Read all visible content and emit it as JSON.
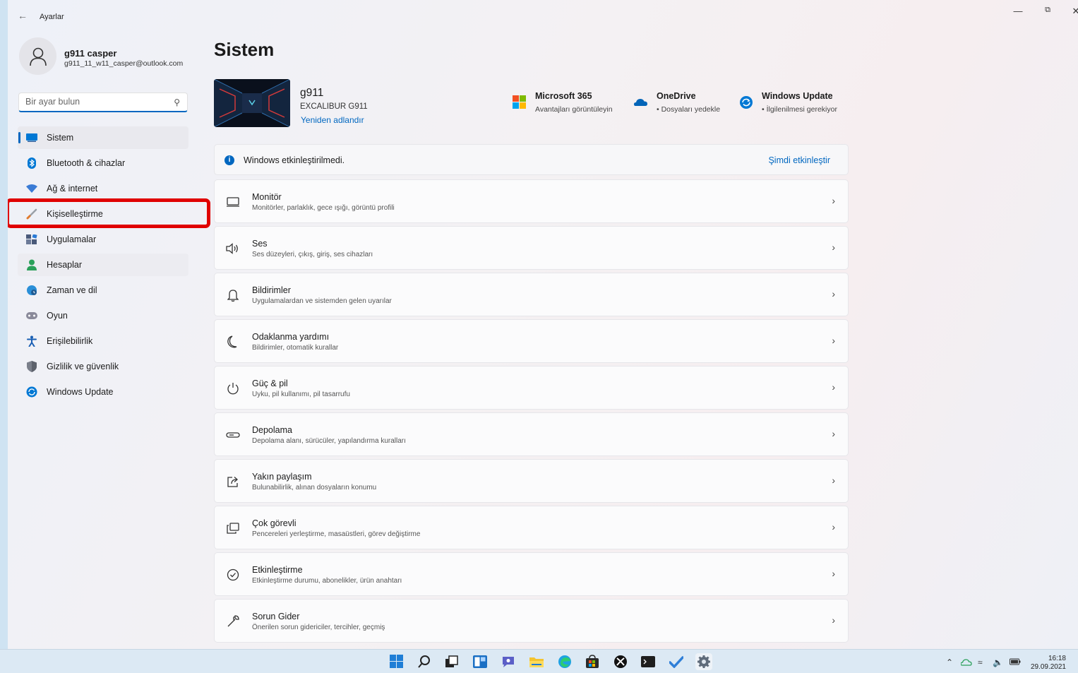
{
  "window": {
    "title": "Ayarlar",
    "back": "←",
    "controls": {
      "minimize": "—",
      "maximize": "⧉",
      "close": "✕"
    }
  },
  "profile": {
    "name": "g911 casper",
    "email": "g911_11_w11_casper@outlook.com"
  },
  "search": {
    "placeholder": "Bir ayar bulun",
    "icon": "search-icon"
  },
  "sidebar": {
    "items": [
      {
        "label": "Sistem",
        "icon": "monitor-icon",
        "color": "#0078d4"
      },
      {
        "label": "Bluetooth & cihazlar",
        "icon": "bluetooth-icon",
        "color": "#0078d4"
      },
      {
        "label": "Ağ & internet",
        "icon": "wifi-icon",
        "color": "#3a7bd5"
      },
      {
        "label": "Kişiselleştirme",
        "icon": "brush-icon",
        "color": "#e07a2e"
      },
      {
        "label": "Uygulamalar",
        "icon": "apps-icon",
        "color": "#4a5a7a"
      },
      {
        "label": "Hesaplar",
        "icon": "person-icon",
        "color": "#2aa05a"
      },
      {
        "label": "Zaman ve dil",
        "icon": "globe-clock-icon",
        "color": "#2a8fd8"
      },
      {
        "label": "Oyun",
        "icon": "gamepad-icon",
        "color": "#8a8a9a"
      },
      {
        "label": "Erişilebilirlik",
        "icon": "accessibility-icon",
        "color": "#1a5fb4"
      },
      {
        "label": "Gizlilik ve güvenlik",
        "icon": "shield-icon",
        "color": "#7a7f8a"
      },
      {
        "label": "Windows Update",
        "icon": "update-icon",
        "color": "#0078d4"
      }
    ]
  },
  "page": {
    "title": "Sistem"
  },
  "device": {
    "name": "g911",
    "model": "EXCALIBUR G911",
    "rename": "Yeniden adlandır"
  },
  "quick_links": [
    {
      "title": "Microsoft 365",
      "sub": "Avantajları görüntüleyin",
      "icon": "microsoft365-icon"
    },
    {
      "title": "OneDrive",
      "sub": "• Dosyaları yedekle",
      "icon": "onedrive-icon"
    },
    {
      "title": "Windows Update",
      "sub": "• İlgilenilmesi gerekiyor",
      "icon": "windows-update-icon"
    }
  ],
  "activation_banner": {
    "info": "i",
    "text": "Windows etkinleştirilmedi.",
    "action": "Şimdi etkinleştir"
  },
  "settings": [
    {
      "title": "Monitör",
      "desc": "Monitörler, parlaklık, gece ışığı, görüntü profili",
      "icon": "display-icon"
    },
    {
      "title": "Ses",
      "desc": "Ses düzeyleri, çıkış, giriş, ses cihazları",
      "icon": "speaker-icon"
    },
    {
      "title": "Bildirimler",
      "desc": "Uygulamalardan ve sistemden gelen uyarılar",
      "icon": "bell-icon"
    },
    {
      "title": "Odaklanma yardımı",
      "desc": "Bildirimler, otomatik kurallar",
      "icon": "moon-icon"
    },
    {
      "title": "Güç & pil",
      "desc": "Uyku, pil kullanımı, pil tasarrufu",
      "icon": "power-icon"
    },
    {
      "title": "Depolama",
      "desc": "Depolama alanı, sürücüler, yapılandırma kuralları",
      "icon": "storage-icon"
    },
    {
      "title": "Yakın paylaşım",
      "desc": "Bulunabilirlik, alınan dosyaların konumu",
      "icon": "share-icon"
    },
    {
      "title": "Çok görevli",
      "desc": "Pencereleri yerleştirme, masaüstleri, görev değiştirme",
      "icon": "multitask-icon"
    },
    {
      "title": "Etkinleştirme",
      "desc": "Etkinleştirme durumu, abonelikler, ürün anahtarı",
      "icon": "check-circle-icon"
    },
    {
      "title": "Sorun Gider",
      "desc": "Önerilen sorun gidericiler, tercihler, geçmiş",
      "icon": "wrench-icon"
    }
  ],
  "taskbar": {
    "apps": [
      "start-icon",
      "search-icon",
      "task-view-icon",
      "widgets-icon",
      "chat-icon",
      "file-explorer-icon",
      "edge-icon",
      "store-icon",
      "xbox-icon",
      "terminal-icon",
      "todo-icon",
      "settings-icon"
    ],
    "time": "16:18",
    "date": "29.09.2021"
  }
}
